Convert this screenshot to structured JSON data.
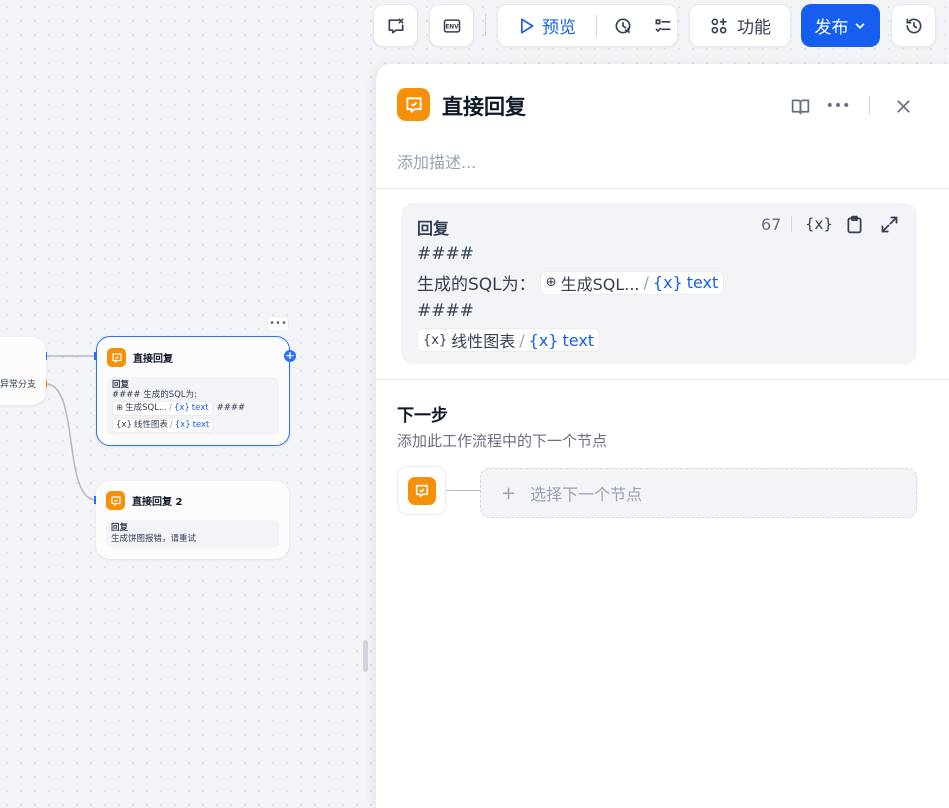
{
  "toolbar": {
    "preview_label": "预览",
    "features_label": "功能",
    "publish_label": "发布",
    "env_label": "ENV"
  },
  "canvas": {
    "partial_branch_label": "异常分支",
    "node1": {
      "title": "直接回复",
      "body_label": "回复",
      "line1": "#### 生成的SQL为:",
      "chip_node": "生成SQL...",
      "chip_var": "text",
      "line2_tail": "####",
      "chip2_node": "线性图表",
      "chip2_var": "text"
    },
    "node2": {
      "title": "直接回复 2",
      "body_label": "回复",
      "line1": "生成饼图报错，请重试"
    }
  },
  "panel": {
    "title": "直接回复",
    "description_placeholder": "添加描述...",
    "reply": {
      "label": "回复",
      "count": "67",
      "line1": "####",
      "line2_prefix": "生成的SQL为：",
      "chip1_node": "生成SQL...",
      "chip1_var": "text",
      "line3": "####",
      "chip2_node": "线性图表",
      "chip2_var": "text"
    },
    "next_step": {
      "title": "下一步",
      "description": "添加此工作流程中的下一个节点",
      "select_placeholder": "选择下一个节点"
    }
  },
  "colors": {
    "accent": "#155eef",
    "node_icon": "#f79009",
    "selected_border": "#2970ff"
  }
}
